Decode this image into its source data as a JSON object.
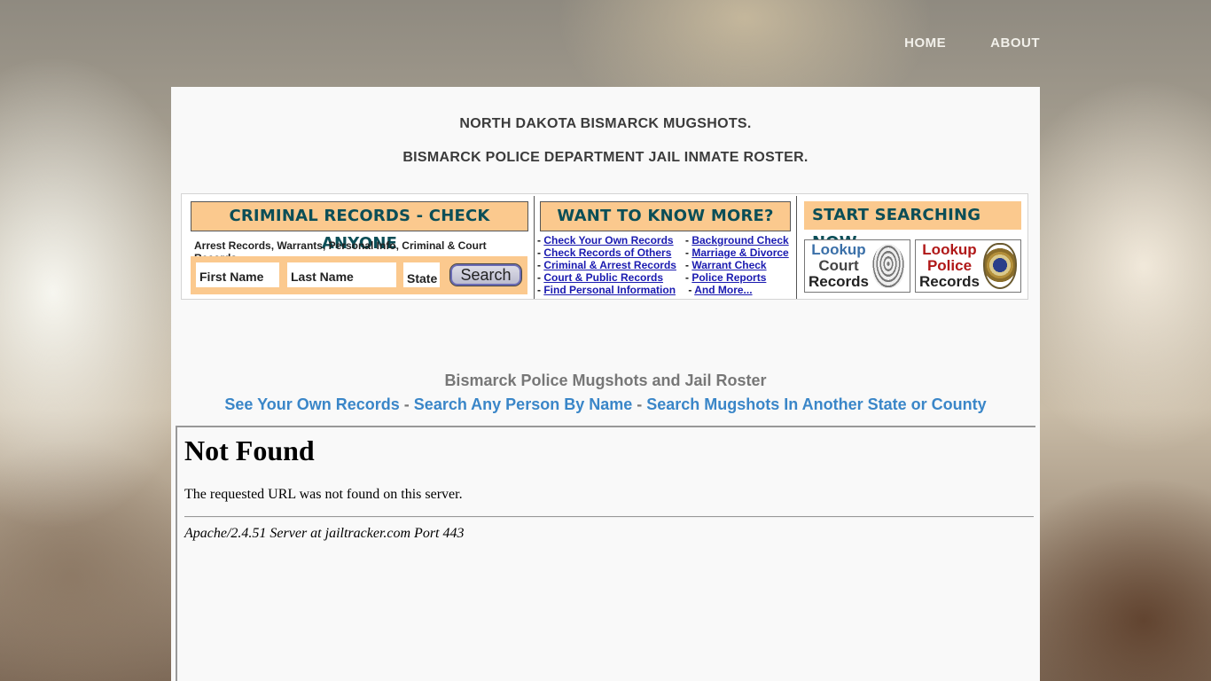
{
  "nav": {
    "home": "HOME",
    "about": "ABOUT"
  },
  "headings": {
    "line1": "NORTH DAKOTA BISMARCK MUGSHOTS.",
    "line2": "BISMARCK POLICE DEPARTMENT JAIL INMATE ROSTER."
  },
  "banner": {
    "criminal": {
      "title": "CRIMINAL RECORDS - CHECK ANYONE",
      "subline": "Arrest Records, Warrants, Personal Info, Criminal & Court Records.",
      "first_name": "First Name",
      "last_name": "Last Name",
      "state": "State",
      "search": "Search"
    },
    "more": {
      "title": "WANT TO KNOW MORE?",
      "left_links": [
        "Check Your Own Records",
        "Check Records of Others",
        "Criminal & Arrest Records",
        "Court & Public Records",
        "Find Personal Information"
      ],
      "right_links": [
        "Background Check",
        "Marriage & Divorce",
        "Warrant Check",
        "Police Reports",
        "And More..."
      ]
    },
    "start": {
      "title": "START SEARCHING NOW",
      "court": {
        "line1": "Lookup",
        "line2": "Court",
        "line3": "Records"
      },
      "police": {
        "line1": "Lookup",
        "line2": "Police",
        "line3": "Records"
      }
    }
  },
  "middle": {
    "title": "Bismarck Police Mugshots and Jail Roster",
    "link1": "See Your Own Records",
    "sep": " - ",
    "link2": "Search Any Person By Name",
    "link3": "Search Mugshots In Another State or County"
  },
  "notfound": {
    "heading": "Not Found",
    "message": "The requested URL was not found on this server.",
    "address": "Apache/2.4.51 Server at jailtracker.com Port 443"
  },
  "colors": {
    "banner_orange": "#fbc98e",
    "banner_title_text": "#0b4e57",
    "link_blue": "#3a86c8",
    "banner_link": "#1a1ab0"
  }
}
